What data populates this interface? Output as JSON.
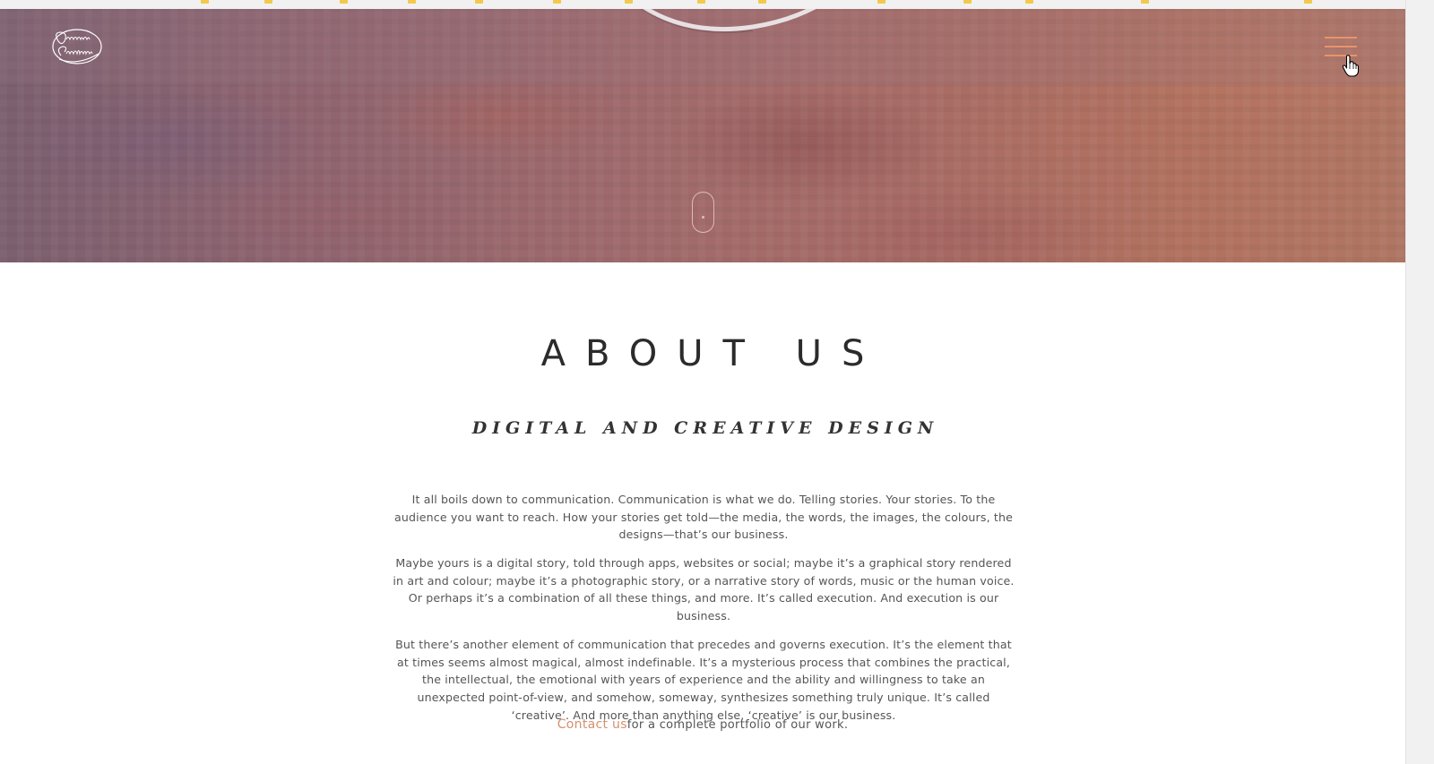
{
  "brand": {
    "logo_name": "Omniart Creative logo"
  },
  "header": {
    "menu_icon": "hamburger-menu-icon",
    "menu_color": "#e8946a"
  },
  "hero": {
    "scroll_icon": "scroll-mouse-icon"
  },
  "about": {
    "title": "ABOUT US",
    "subtitle": "DIGITAL AND CREATIVE DESIGN",
    "paragraphs": [
      "It all boils down to communication. Communication is what we do. Telling stories. Your stories. To the audience you want to reach. How your stories get told—the media, the words, the images, the colours, the designs—that’s our business.",
      "Maybe yours is a digital story, told through apps, websites or social; maybe it’s a graphical story rendered in art and colour; maybe it’s a photographic story, or a narrative story of words, music or the human voice. Or perhaps it’s a combination of all these things, and more. It’s called execution. And execution is our business.",
      "But there’s another element of communication that precedes and governs execution. It’s the element that at times seems almost magical, almost indefinable. It’s a mysterious process that combines the practical, the intellectual, the emotional with years of experience and the ability and willingness to take an unexpected point-of-view, and somehow, someway, synthesizes something truly unique. It’s called ‘creative’. And more than anything else, ‘creative’ is our business."
    ],
    "contact_link": "Contact us",
    "contact_suffix": "for a complete portfolio of our work.",
    "accent_color": "#d4906e"
  }
}
